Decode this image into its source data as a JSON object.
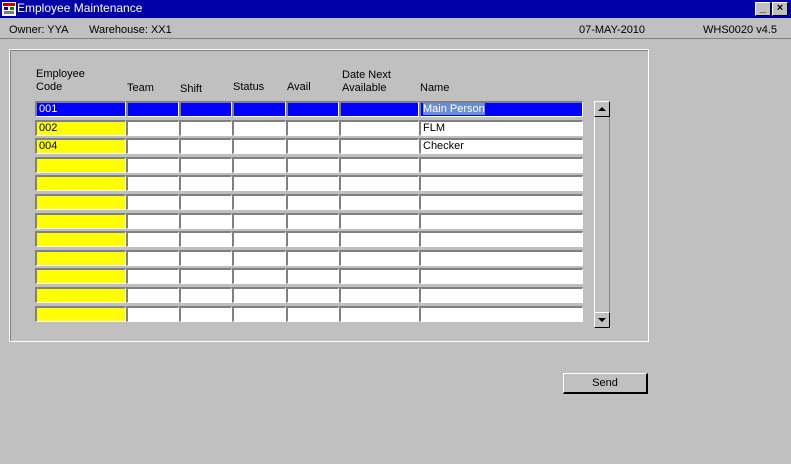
{
  "window": {
    "title": "Employee Maintenance",
    "minimize_glyph": "_",
    "close_glyph": "×",
    "icon": "app-window-icon"
  },
  "info": {
    "owner": "Owner: YYA",
    "warehouse": "Warehouse: XX1",
    "date": "07-MAY-2010",
    "program": "WHS0020 v4.5"
  },
  "table": {
    "headers": {
      "code": [
        "Employee",
        "Code"
      ],
      "team": "Team",
      "shift": "Shift",
      "status": "Status",
      "avail": "Avail",
      "date_next": [
        "Date Next",
        "Available"
      ],
      "name": "Name"
    },
    "rows": [
      {
        "code": "001",
        "team": "",
        "shift": "",
        "status": "",
        "avail": "",
        "date_next": "",
        "name": "Main Person"
      },
      {
        "code": "002",
        "team": "",
        "shift": "",
        "status": "",
        "avail": "",
        "date_next": "",
        "name": "FLM"
      },
      {
        "code": "004",
        "team": "",
        "shift": "",
        "status": "",
        "avail": "",
        "date_next": "",
        "name": "Checker"
      },
      {
        "code": "",
        "team": "",
        "shift": "",
        "status": "",
        "avail": "",
        "date_next": "",
        "name": ""
      },
      {
        "code": "",
        "team": "",
        "shift": "",
        "status": "",
        "avail": "",
        "date_next": "",
        "name": ""
      },
      {
        "code": "",
        "team": "",
        "shift": "",
        "status": "",
        "avail": "",
        "date_next": "",
        "name": ""
      },
      {
        "code": "",
        "team": "",
        "shift": "",
        "status": "",
        "avail": "",
        "date_next": "",
        "name": ""
      },
      {
        "code": "",
        "team": "",
        "shift": "",
        "status": "",
        "avail": "",
        "date_next": "",
        "name": ""
      },
      {
        "code": "",
        "team": "",
        "shift": "",
        "status": "",
        "avail": "",
        "date_next": "",
        "name": ""
      },
      {
        "code": "",
        "team": "",
        "shift": "",
        "status": "",
        "avail": "",
        "date_next": "",
        "name": ""
      },
      {
        "code": "",
        "team": "",
        "shift": "",
        "status": "",
        "avail": "",
        "date_next": "",
        "name": ""
      },
      {
        "code": "",
        "team": "",
        "shift": "",
        "status": "",
        "avail": "",
        "date_next": "",
        "name": ""
      }
    ],
    "selected_row": 0
  },
  "buttons": {
    "send": "Send"
  },
  "colors": {
    "titlebar": "#0000a8",
    "selected_row": "#0000ff",
    "key_field": "#ffff00",
    "background": "#c0c0c0"
  }
}
